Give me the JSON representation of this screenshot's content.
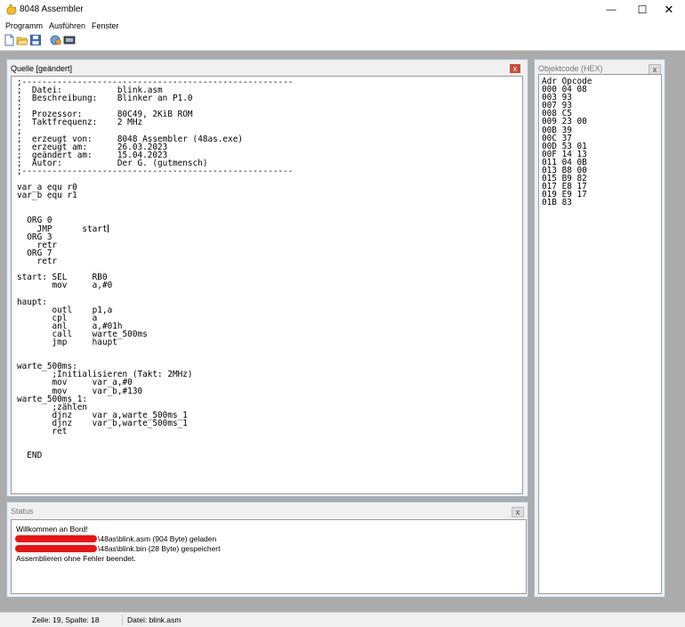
{
  "window": {
    "title": "8048 Assembler",
    "icon": "hand-icon",
    "controls": {
      "minimize": "—",
      "maximize": "☐",
      "close": "✕"
    }
  },
  "menu": [
    "Programm",
    "Ausführen",
    "Fenster"
  ],
  "toolbar": {
    "icons": [
      "new-file-icon",
      "open-folder-icon",
      "save-icon",
      "assemble-icon",
      "terminal-icon"
    ]
  },
  "source_panel": {
    "title": "Quelle [geändert]",
    "close": "x",
    "lines": [
      ";------------------------------------------------------",
      ";  Datei:           blink.asm",
      ";  Beschreibung:    Blinker an P1.0",
      ";",
      ";  Prozessor:       80C49, 2KiB ROM",
      ";  Taktfrequenz:    2 MHz",
      ";",
      ";  erzeugt von:     8048 Assembler (48as.exe)",
      ";  erzeugt am:      26.03.2023",
      ";  geändert am:     15.04.2023",
      ";  Autor:           Der G. (gutmensch)",
      ";------------------------------------------------------",
      "",
      "var_a equ r0",
      "var_b equ r1",
      "",
      "",
      "  ORG 0",
      "    JMP      start",
      "  ORG 3",
      "    retr",
      "  ORG 7",
      "    retr",
      "",
      "start: SEL     RB0",
      "       mov     a,#0",
      "",
      "haupt:",
      "       outl    p1,a",
      "       cpl     a",
      "       anl     a,#01h",
      "       call    warte_500ms",
      "       jmp     haupt",
      "",
      "",
      "warte_500ms:",
      "       ;Initialisieren (Takt: 2MHz)",
      "       mov     var_a,#0",
      "       mov     var_b,#130",
      "warte_500ms_1:",
      "       ;zählen",
      "       djnz    var_a,warte_500ms_1",
      "       djnz    var_b,warte_500ms_1",
      "       ret",
      "",
      "",
      "  END"
    ]
  },
  "object_panel": {
    "title": "Objektcode (HEX)",
    "close": "x",
    "lines": [
      "Adr Opcode",
      "000 04 08",
      "003 93",
      "007 93",
      "008 C5",
      "009 23 00",
      "00B 39",
      "00C 37",
      "00D 53 01",
      "00F 14 13",
      "011 04 0B",
      "013 B8 00",
      "015 B9 82",
      "017 E8 17",
      "019 E9 17",
      "01B 83"
    ]
  },
  "status_panel": {
    "title": "Status",
    "close": "x",
    "lines": [
      "Willkommen an Bord!",
      "\\48as\\blink.asm (904 Byte) geladen",
      "\\48as\\blink.bin (28 Byte) gespeichert",
      "Assemblieren ohne Fehler beendet."
    ]
  },
  "statusbar": {
    "position": "Zeile: 19, Spalte: 18",
    "file": "Datei: blink.asm"
  },
  "colors": {
    "workspace": "#ababab",
    "panel": "#f0f0f0",
    "close_active": "#c94b3a",
    "redaction": "#ee1111"
  }
}
